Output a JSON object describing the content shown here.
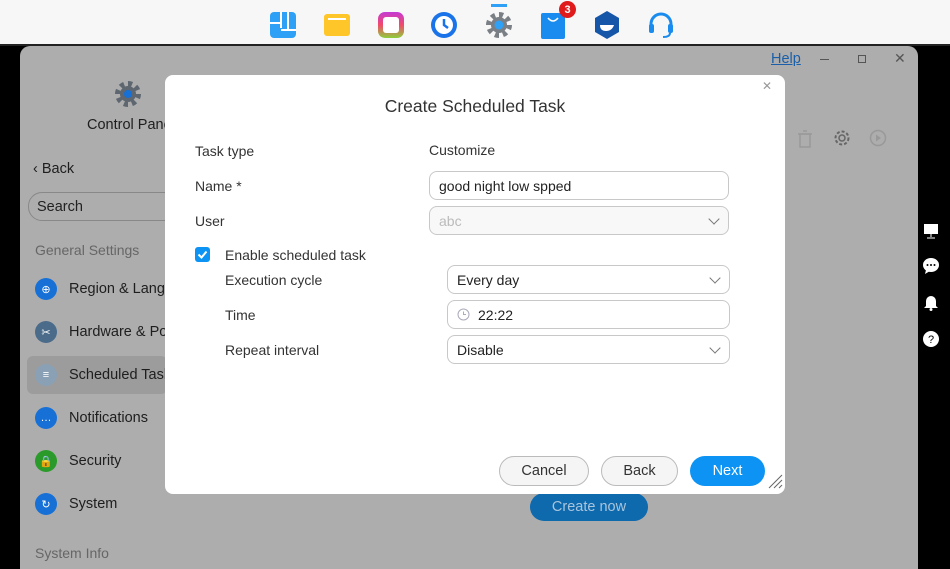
{
  "dock": {
    "apps": [
      {
        "icon": "dashboard-icon",
        "color": "#2ea0f5"
      },
      {
        "icon": "folder-icon",
        "color": "#ffc629"
      },
      {
        "icon": "photos-icon",
        "color": "#e23bb0"
      },
      {
        "icon": "backup-clock-icon",
        "color": "#1a73e8"
      },
      {
        "icon": "settings-gear-icon",
        "color": "#7a7f86",
        "active": true
      },
      {
        "icon": "app-store-bag-icon",
        "color": "#1a8cf0",
        "badge": "3"
      },
      {
        "icon": "docker-icon",
        "color": "#1656a8"
      },
      {
        "icon": "support-headset-icon",
        "color": "#1a8cf0"
      }
    ]
  },
  "window": {
    "help": "Help",
    "app_title": "Control Panel",
    "back": "Back",
    "search_placeholder": "Search",
    "section_general": "General Settings",
    "section_info": "System Info",
    "sidebar": [
      {
        "label": "Region & Language",
        "icon": "globe-icon",
        "color": "#1670d6"
      },
      {
        "label": "Hardware & Power",
        "icon": "tools-icon",
        "color": "#4a6b8a"
      },
      {
        "label": "Scheduled Tasks",
        "icon": "task-list-icon",
        "color": "#8aa0b4",
        "active": true
      },
      {
        "label": "Notifications",
        "icon": "chat-bubble-icon",
        "color": "#1670d6"
      },
      {
        "label": "Security",
        "icon": "shield-lock-icon",
        "color": "#2a9a2a"
      },
      {
        "label": "System",
        "icon": "system-refresh-icon",
        "color": "#1670d6"
      }
    ],
    "create_now": "Create now"
  },
  "dialog": {
    "title": "Create Scheduled Task",
    "task_type_label": "Task type",
    "task_type_value": "Customize",
    "name_label": "Name *",
    "name_value": "good night low spped",
    "user_label": "User",
    "user_value": "abc",
    "enable_label": "Enable scheduled task",
    "enable_checked": true,
    "cycle_label": "Execution cycle",
    "cycle_value": "Every day",
    "time_label": "Time",
    "time_value": "22:22",
    "repeat_label": "Repeat interval",
    "repeat_value": "Disable",
    "cancel": "Cancel",
    "back": "Back",
    "next": "Next",
    "accent": "#0d93f3"
  }
}
